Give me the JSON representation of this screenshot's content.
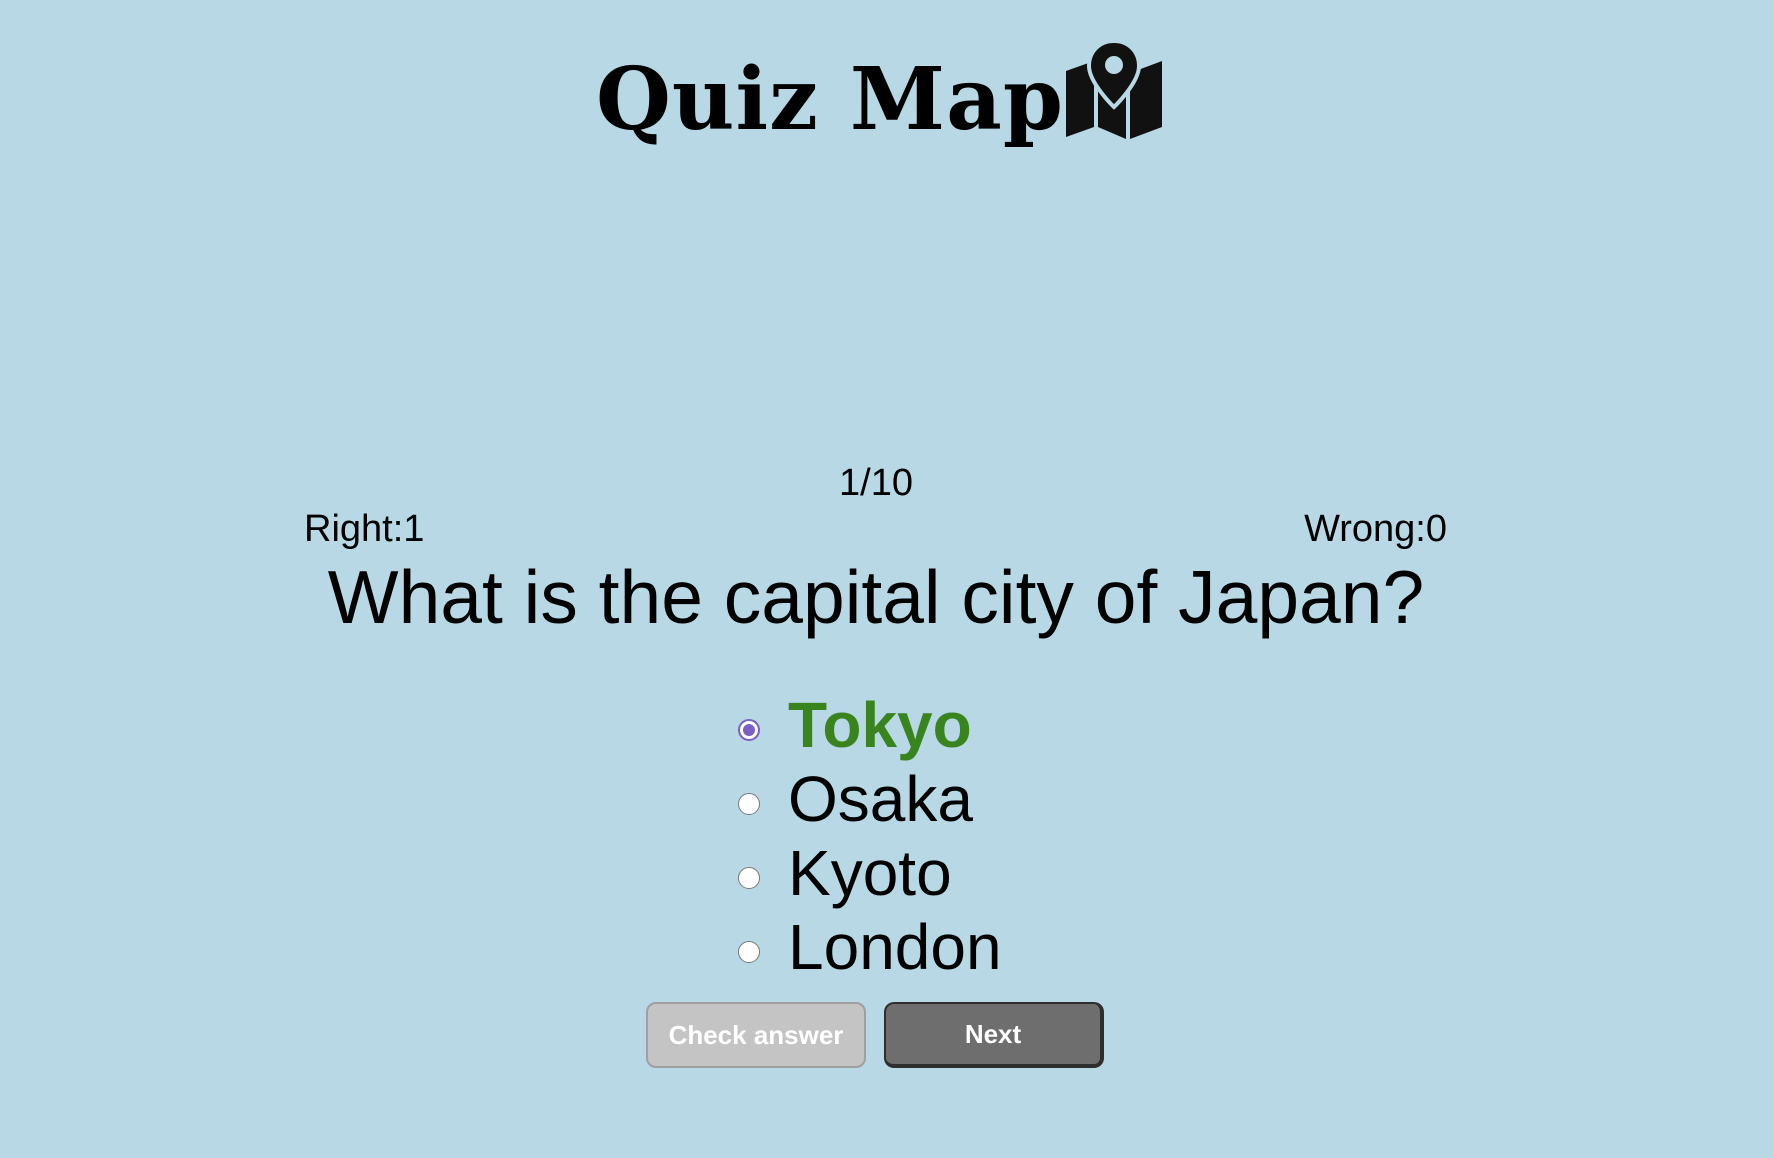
{
  "app": {
    "title": "Quiz Map",
    "logo_icon": "map-pin-icon"
  },
  "progress": {
    "counter": "1/10"
  },
  "score": {
    "right": "Right:1",
    "wrong": "Wrong:0"
  },
  "question": {
    "text": "What is the capital city of Japan?"
  },
  "options": [
    {
      "label": "Tokyo",
      "selected": true,
      "correct": true
    },
    {
      "label": "Osaka",
      "selected": false
    },
    {
      "label": "Kyoto",
      "selected": false
    },
    {
      "label": "London",
      "selected": false
    }
  ],
  "buttons": {
    "check_label": "Check answer",
    "next_label": "Next"
  },
  "colors": {
    "background": "#b7d8e4",
    "correct": "#3a8420",
    "radio_selected": "#7b5fc4",
    "check_button": "#c4c4c4",
    "next_button": "#6e6e6e"
  }
}
